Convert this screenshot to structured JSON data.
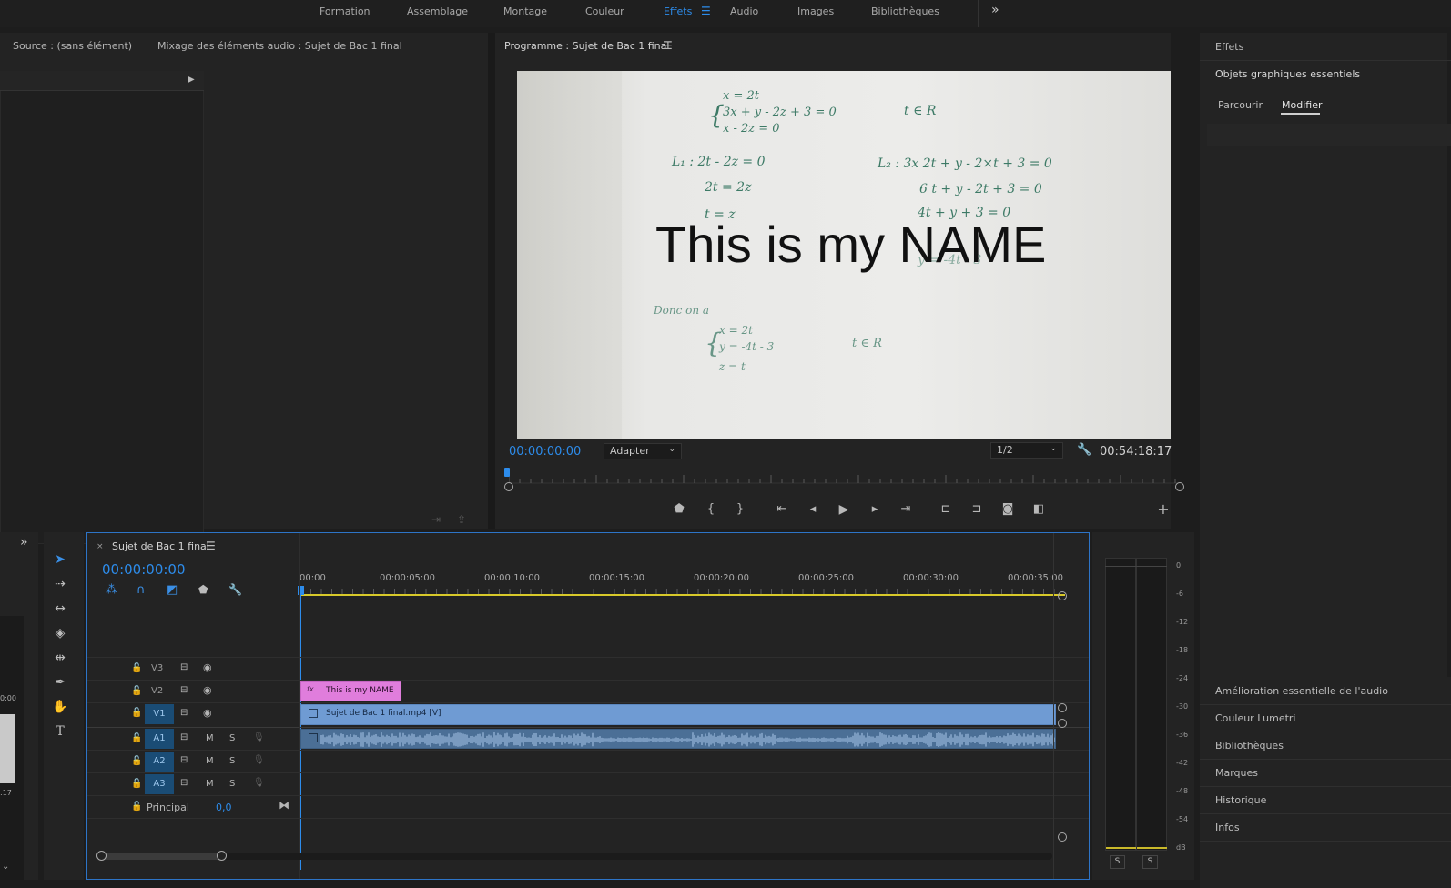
{
  "workspace_tabs": [
    {
      "label": "Formation"
    },
    {
      "label": "Assemblage"
    },
    {
      "label": "Montage"
    },
    {
      "label": "Couleur"
    },
    {
      "label": "Effets"
    },
    {
      "label": "Audio"
    },
    {
      "label": "Images"
    },
    {
      "label": "Bibliothèques"
    }
  ],
  "left_panel": {
    "source_tab": "Source : (sans élément)",
    "audio_mixer_tab": "Mixage des éléments audio : Sujet de Bac 1 final",
    "partial_time_label": "0:00",
    "partial_time_label_2": ":17"
  },
  "program_monitor": {
    "title": "Programme : Sujet de Bac 1 final",
    "current_time": "00:00:00:00",
    "fit_dropdown": "Adapter",
    "resolution_dropdown": "1/2",
    "duration": "00:54:18:17",
    "overlay_text": "This is my NAME"
  },
  "timeline": {
    "sequence_title": "Sujet de Bac 1 final",
    "timecode": "00:00:00:00",
    "ruler_labels": [
      "00:00",
      "00:00:05:00",
      "00:00:10:00",
      "00:00:15:00",
      "00:00:20:00",
      "00:00:25:00",
      "00:00:30:00",
      "00:00:35:00"
    ],
    "video_tracks": [
      "V3",
      "V2",
      "V1"
    ],
    "audio_tracks": [
      "A1",
      "A2",
      "A3"
    ],
    "mute_label": "M",
    "solo_label": "S",
    "master_label": "Principal",
    "master_value": "0,0",
    "clips": {
      "title_clip": "This is my NAME",
      "title_clip_badge": "fx",
      "video_clip": "Sujet de Bac 1 final.mp4 [V]",
      "title_clip_color": "#e07ddc",
      "video_clip_color": "#6f9bd3"
    }
  },
  "audio_meter": {
    "scale": [
      "0",
      "-6",
      "-12",
      "-18",
      "-24",
      "-30",
      "-36",
      "-42",
      "-48",
      "-54",
      "dB"
    ],
    "solo_buttons": [
      "S",
      "S"
    ]
  },
  "right_panel": {
    "effects_tab": "Effets",
    "essential_graphics_tab": "Objets graphiques essentiels",
    "subtabs": [
      "Parcourir",
      "Modifier"
    ],
    "active_subtab": "Modifier",
    "collapsed_panels": [
      "Amélioration essentielle de l'audio",
      "Couleur Lumetri",
      "Bibliothèques",
      "Marques",
      "Historique",
      "Infos"
    ]
  },
  "video_frame": {
    "handwriting": [
      "x = 2t",
      "3x + y - 2z + 3 = 0",
      "x - 2z = 0",
      "t ∈ R",
      "L₁ :  2t  -  2z = 0",
      "2t  =  2z",
      "t = z",
      "L₂ :  3x 2t  + y  - 2×t + 3 = 0",
      "6 t  + y - 2t + 3 = 0",
      "4t + y + 3 = 0",
      "y = -4t - 3",
      "Donc   on  a",
      "x  =  2t",
      "y =  -4t - 3",
      "z = t",
      "t  ∈ R"
    ]
  },
  "icons": {
    "menu": "hamburger-icon",
    "overflow": "double-chevron-icon"
  }
}
